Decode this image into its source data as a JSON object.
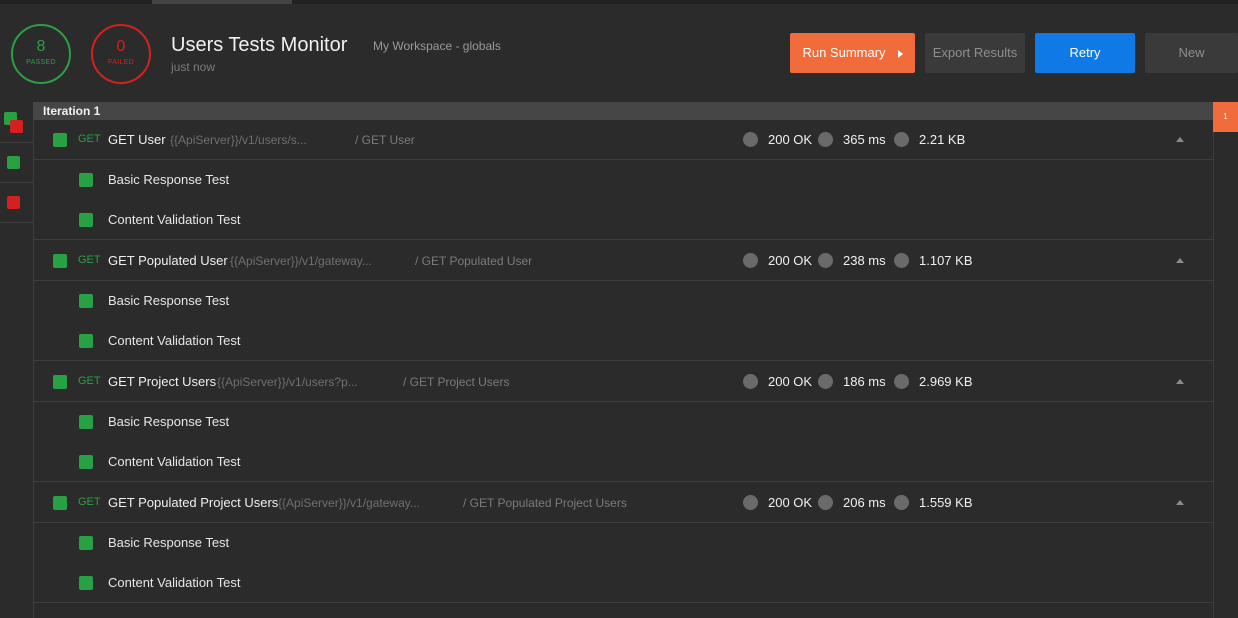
{
  "summary": {
    "passed_count": "8",
    "passed_label": "PASSED",
    "failed_count": "0",
    "failed_label": "FAILED"
  },
  "header": {
    "title": "Users Tests Monitor",
    "workspace": "My Workspace - globals",
    "time": "just now",
    "run_summary_label": "Run Summary",
    "export_label": "Export Results",
    "retry_label": "Retry",
    "new_label": "New"
  },
  "right_tab_label": "1",
  "iteration_label": "Iteration 1",
  "colors": {
    "pass": "#27a143",
    "fail": "#d6201f",
    "accent": "#f26b3a",
    "primary": "#0f7ae5"
  },
  "requests": [
    {
      "method": "GET",
      "name": "GET User",
      "url": "{{ApiServer}}/v1/users/s...",
      "path": "/ GET User",
      "status": "200 OK",
      "time": "365 ms",
      "size": "2.21 KB",
      "tests": [
        {
          "name": "Basic Response Test"
        },
        {
          "name": "Content Validation Test"
        }
      ]
    },
    {
      "method": "GET",
      "name": "GET Populated User",
      "url": "{{ApiServer}}/v1/gateway...",
      "path": "/ GET Populated User",
      "status": "200 OK",
      "time": "238 ms",
      "size": "1.107 KB",
      "tests": [
        {
          "name": "Basic Response Test"
        },
        {
          "name": "Content Validation Test"
        }
      ]
    },
    {
      "method": "GET",
      "name": "GET Project Users",
      "url": "{{ApiServer}}/v1/users?p...",
      "path": "/ GET Project Users",
      "status": "200 OK",
      "time": "186 ms",
      "size": "2.969 KB",
      "tests": [
        {
          "name": "Basic Response Test"
        },
        {
          "name": "Content Validation Test"
        }
      ]
    },
    {
      "method": "GET",
      "name": "GET Populated Project Users",
      "url": "{{ApiServer}}/v1/gateway...",
      "path": "/ GET Populated Project Users",
      "status": "200 OK",
      "time": "206 ms",
      "size": "1.559 KB",
      "tests": [
        {
          "name": "Basic Response Test"
        },
        {
          "name": "Content Validation Test"
        }
      ]
    }
  ]
}
